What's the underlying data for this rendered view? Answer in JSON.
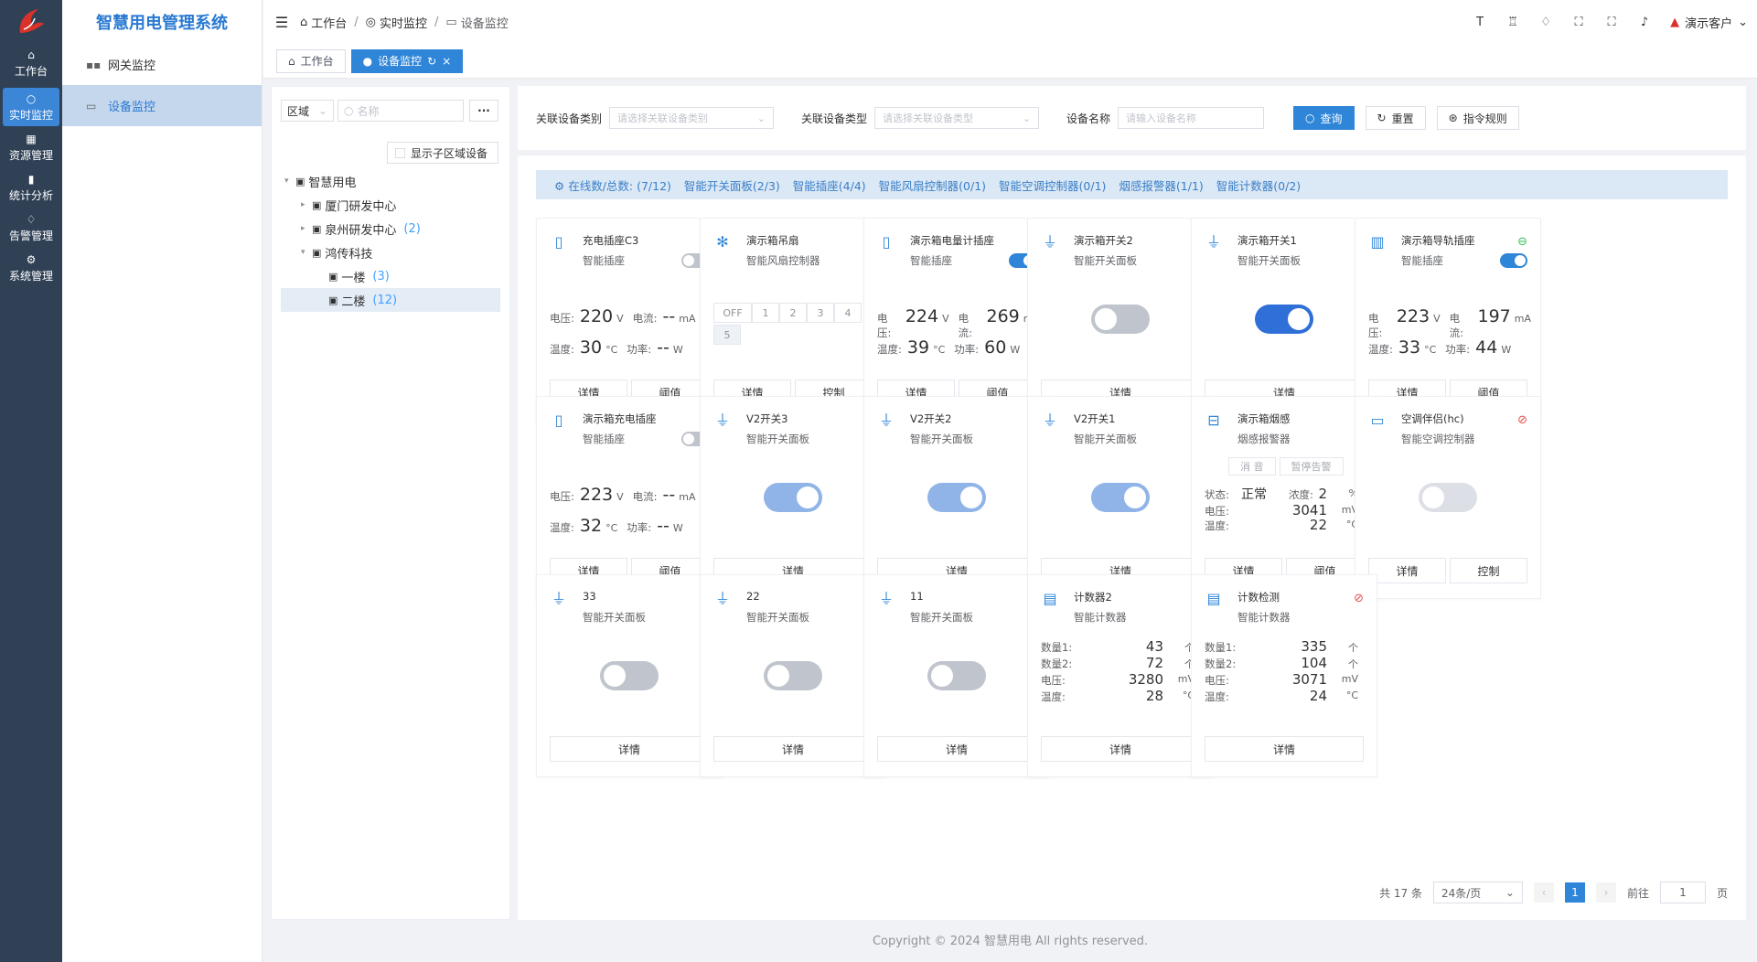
{
  "app": {
    "title": "智慧用电管理系统"
  },
  "rail": [
    {
      "icon": "home-icon",
      "label": "工作台"
    },
    {
      "icon": "monitor-icon",
      "label": "实时监控"
    },
    {
      "icon": "grid-icon",
      "label": "资源管理"
    },
    {
      "icon": "bar-chart-icon",
      "label": "统计分析"
    },
    {
      "icon": "bell-icon",
      "label": "告警管理"
    },
    {
      "icon": "gear-icon",
      "label": "系统管理"
    }
  ],
  "submenu": [
    {
      "label": "网关监控"
    },
    {
      "label": "设备监控"
    }
  ],
  "breadcrumb": [
    "工作台",
    "实时监控",
    "设备监控"
  ],
  "header_user": "演示客户",
  "tabs": [
    "工作台",
    "设备监控"
  ],
  "tree_panel": {
    "area_select": "区域",
    "search_placeholder": "名称",
    "show_sub": "显示子区域设备",
    "nodes": [
      {
        "label": "智慧用电",
        "count": ""
      },
      {
        "label": "厦门研发中心",
        "count": ""
      },
      {
        "label": "泉州研发中心",
        "count": "(2)"
      },
      {
        "label": "鸿传科技",
        "count": ""
      },
      {
        "label": "一楼",
        "count": "(3)"
      },
      {
        "label": "二楼",
        "count": "(12)"
      }
    ]
  },
  "filter": {
    "category_label": "关联设备类别",
    "category_placeholder": "请选择关联设备类别",
    "type_label": "关联设备类型",
    "type_placeholder": "请选择关联设备类型",
    "name_label": "设备名称",
    "name_placeholder": "请输入设备名称",
    "query": "查询",
    "reset": "重置",
    "rules": "指令规则"
  },
  "stats": {
    "total": "在线数/总数: (7/12)",
    "items": [
      "智能开关面板(2/3)",
      "智能插座(4/4)",
      "智能风扇控制器(0/1)",
      "智能空调控制器(0/1)",
      "烟感报警器(1/1)",
      "智能计数器(0/2)"
    ]
  },
  "labels": {
    "voltage": "电压:",
    "current": "电流:",
    "temp": "温度:",
    "power": "功率:",
    "detail": "详情",
    "threshold": "阈值",
    "control": "控制",
    "status": "状态:",
    "density": "浓度:",
    "count1": "数量1:",
    "count2": "数量2:",
    "mute": "消 音",
    "pause_alarm": "暂停告警",
    "u_v": "V",
    "u_ma": "mA",
    "u_c": "°C",
    "u_w": "W",
    "u_pct": "%",
    "u_mv": "mV",
    "u_ge": "个"
  },
  "devices": [
    {
      "name": "充电插座C3",
      "type": "智能插座",
      "icon": "socket-icon",
      "online": true,
      "switch": false,
      "voltage": "220",
      "current": "--",
      "temp": "30",
      "power": "--"
    },
    {
      "name": "演示箱吊扇",
      "type": "智能风扇控制器",
      "icon": "fan-icon",
      "online": false,
      "fan": [
        "OFF",
        "1",
        "2",
        "3",
        "4",
        "5"
      ]
    },
    {
      "name": "演示箱电量计插座",
      "type": "智能插座",
      "icon": "socket-icon",
      "online": true,
      "switch": true,
      "voltage": "224",
      "current": "269",
      "temp": "39",
      "power": "60"
    },
    {
      "name": "演示箱开关2",
      "type": "智能开关面板",
      "icon": "switch-panel-icon",
      "online": true,
      "switch": false
    },
    {
      "name": "演示箱开关1",
      "type": "智能开关面板",
      "icon": "switch-panel-icon",
      "online": true,
      "switch": true
    },
    {
      "name": "演示箱导轨插座",
      "type": "智能插座",
      "icon": "rail-socket-icon",
      "online": true,
      "switch": true,
      "voltage": "223",
      "current": "197",
      "temp": "33",
      "power": "44"
    },
    {
      "name": "演示箱充电插座",
      "type": "智能插座",
      "icon": "socket-icon",
      "online": true,
      "switch": false,
      "voltage": "223",
      "current": "--",
      "temp": "32",
      "power": "--"
    },
    {
      "name": "V2开关3",
      "type": "智能开关面板",
      "icon": "switch-panel-icon",
      "online": false,
      "switch": true
    },
    {
      "name": "V2开关2",
      "type": "智能开关面板",
      "icon": "switch-panel-icon",
      "online": false,
      "switch": true
    },
    {
      "name": "V2开关1",
      "type": "智能开关面板",
      "icon": "switch-panel-icon",
      "online": false,
      "switch": true
    },
    {
      "name": "演示箱烟感",
      "type": "烟感报警器",
      "icon": "smoke-detector-icon",
      "online": true,
      "status": "正常",
      "density": "2",
      "voltage": "3041",
      "temp": "22"
    },
    {
      "name": "空调伴侣(hc)",
      "type": "智能空调控制器",
      "icon": "air-conditioner-icon",
      "online": false,
      "switch": false
    },
    {
      "name": "33",
      "type": "智能开关面板",
      "icon": "switch-panel-icon",
      "online": true,
      "switch": false
    },
    {
      "name": "22",
      "type": "智能开关面板",
      "icon": "switch-panel-icon",
      "online": true,
      "switch": false
    },
    {
      "name": "11",
      "type": "智能开关面板",
      "icon": "switch-panel-icon",
      "online": true,
      "switch": false
    },
    {
      "name": "计数器2",
      "type": "智能计数器",
      "icon": "counter-icon",
      "online": false,
      "count1": "43",
      "count2": "72",
      "voltage": "3280",
      "temp": "28"
    },
    {
      "name": "计数检测",
      "type": "智能计数器",
      "icon": "counter-icon",
      "online": false,
      "count1": "335",
      "count2": "104",
      "voltage": "3071",
      "temp": "24"
    }
  ],
  "pager": {
    "total": "共 17 条",
    "size": "24条/页",
    "page": "1",
    "goto": "前往",
    "goto_val": "1",
    "unit": "页"
  },
  "footer": "Copyright © 2024 智慧用电 All rights reserved."
}
